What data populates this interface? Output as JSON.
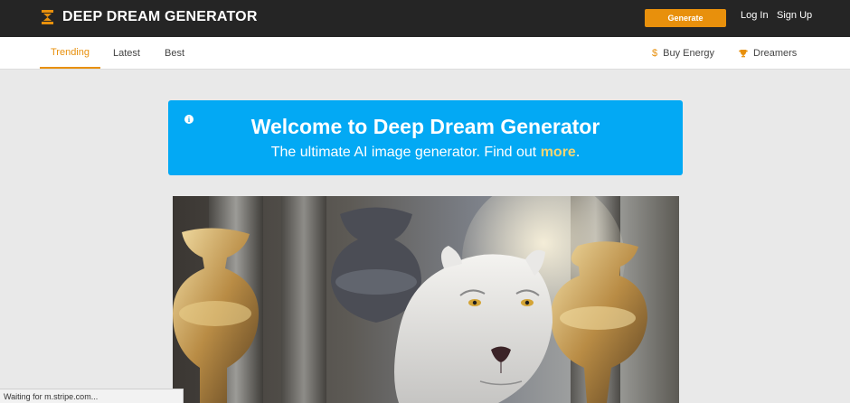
{
  "header": {
    "logo_text": "DEEP DREAM GENERATOR",
    "generate_label": "Generate",
    "login_label": "Log In",
    "signup_label": "Sign Up",
    "accent_color": "#e8900c"
  },
  "subnav": {
    "tabs": [
      {
        "label": "Trending",
        "active": true
      },
      {
        "label": "Latest",
        "active": false
      },
      {
        "label": "Best",
        "active": false
      }
    ],
    "buy_energy_label": "Buy Energy",
    "buy_energy_icon": "dollar-icon",
    "dreamers_label": "Dreamers",
    "dreamers_icon": "trophy-icon"
  },
  "banner": {
    "title": "Welcome to Deep Dream Generator",
    "subtitle_prefix": "The ultimate AI image generator. Find out ",
    "more_link": "more",
    "subtitle_suffix": ".",
    "background_color": "#03a9f4",
    "icon": "info-icon"
  },
  "status": {
    "text": "Waiting for m.stripe.com..."
  }
}
